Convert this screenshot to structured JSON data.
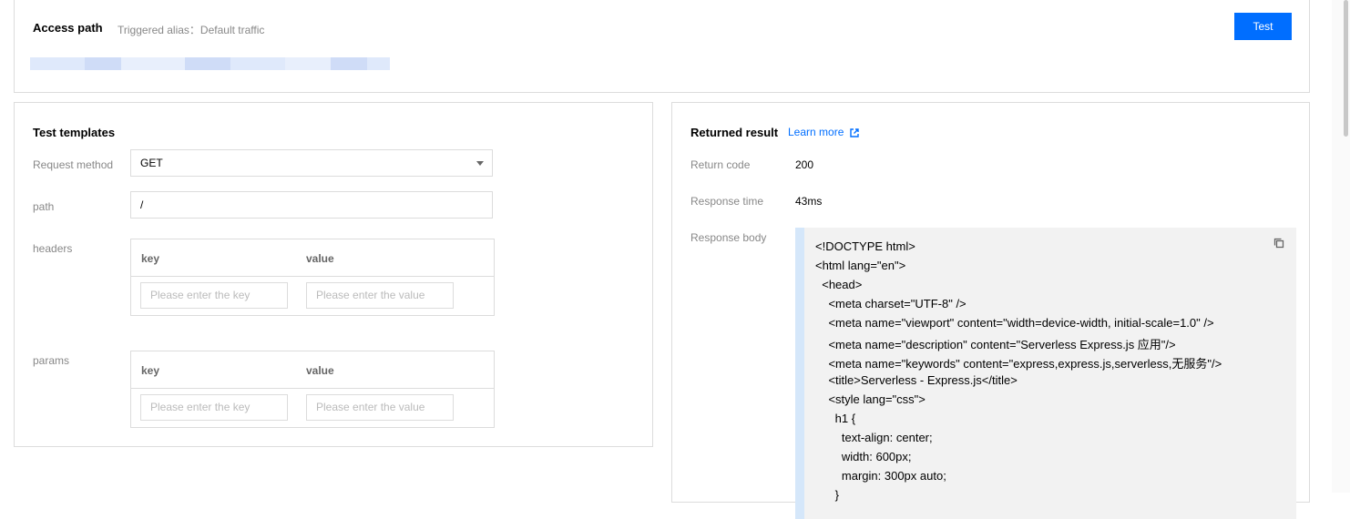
{
  "access": {
    "title": "Access path",
    "alias": "Triggered alias：Default traffic",
    "test_button": "Test"
  },
  "templates": {
    "title": "Test templates",
    "request_method_label": "Request method",
    "request_method_value": "GET",
    "path_label": "path",
    "path_value": "/",
    "headers_label": "headers",
    "params_label": "params",
    "key_header": "key",
    "value_header": "value",
    "key_placeholder": "Please enter the key",
    "value_placeholder": "Please enter the value"
  },
  "result": {
    "title": "Returned result",
    "learn_more": "Learn more",
    "return_code_label": "Return code",
    "return_code_value": "200",
    "response_time_label": "Response time",
    "response_time_value": "43ms",
    "response_body_label": "Response body",
    "body_lines": [
      "<!DOCTYPE html>",
      "<html lang=\"en\">",
      "  <head>",
      "    <meta charset=\"UTF-8\" />",
      "    <meta name=\"viewport\" content=\"width=device-width, initial-scale=1.0\" />",
      "    <meta name=\"description\" content=\"Serverless Express.js 应用\"/>",
      "    <meta name=\"keywords\" content=\"express,express.js,serverless,无服务\"/>",
      "    <title>Serverless - Express.js</title>",
      "    <style lang=\"css\">",
      "      h1 {",
      "        text-align: center;",
      "        width: 600px;",
      "        margin: 300px auto;",
      "      }"
    ]
  },
  "colors": {
    "primary": "#006eff",
    "border": "#dcdcdc",
    "code_bg": "#f2f2f2",
    "code_accent": "#d5e7fa"
  }
}
